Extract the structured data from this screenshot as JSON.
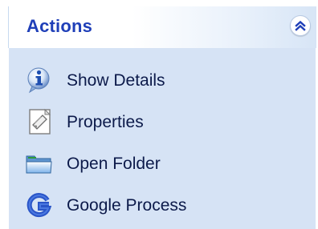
{
  "panel": {
    "title": "Actions",
    "collapse_icon": "double-chevron-up-icon",
    "items": [
      {
        "label": "Show Details",
        "icon": "info-icon"
      },
      {
        "label": "Properties",
        "icon": "properties-icon"
      },
      {
        "label": "Open Folder",
        "icon": "folder-icon"
      },
      {
        "label": "Google Process",
        "icon": "google-icon"
      }
    ]
  },
  "colors": {
    "title": "#1f3fb8",
    "body_background": "#d6e3f5",
    "item_text": "#0c1a4a"
  }
}
